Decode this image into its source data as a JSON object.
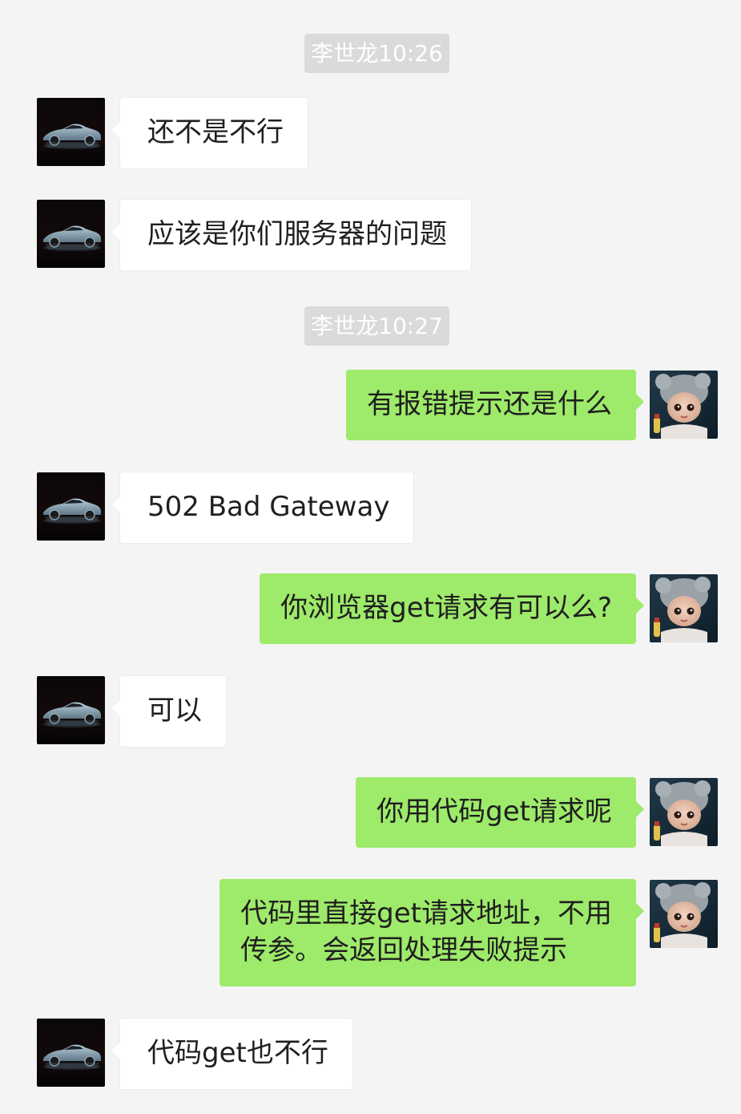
{
  "timestamps": [
    {
      "text": "李世龙10:26"
    },
    {
      "text": "李世龙10:27"
    }
  ],
  "avatars": {
    "contact": {
      "icon": "car-avatar-icon"
    },
    "self": {
      "icon": "doll-avatar-icon"
    }
  },
  "messages": [
    {
      "sender": "contact",
      "text": "还不是不行"
    },
    {
      "sender": "contact",
      "text": "应该是你们服务器的问题"
    },
    {
      "sender": "self",
      "text": "有报错提示还是什么"
    },
    {
      "sender": "contact",
      "text": "502 Bad Gateway"
    },
    {
      "sender": "self",
      "text": "你浏览器get请求有可以么?"
    },
    {
      "sender": "contact",
      "text": "可以"
    },
    {
      "sender": "self",
      "text": "你用代码get请求呢"
    },
    {
      "sender": "self",
      "lines": [
        "代码里直接get请求地址，不用",
        "传参。会返回处理失败提示"
      ]
    },
    {
      "sender": "contact",
      "text": "代码get也不行"
    }
  ],
  "colors": {
    "background": "#f4f4f4",
    "incoming_bubble": "#ffffff",
    "outgoing_bubble": "#9eea6a",
    "timestamp_bg": "#dadada",
    "timestamp_text": "#ffffff"
  }
}
